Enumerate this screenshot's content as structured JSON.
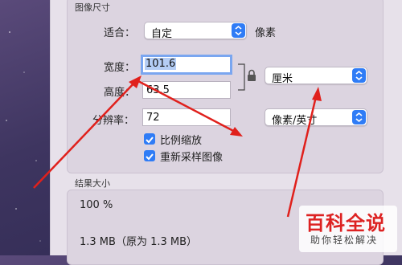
{
  "section_image_size": {
    "title": "图像尺寸"
  },
  "fit": {
    "label": "适合：",
    "value": "自定",
    "unit": "像素"
  },
  "width": {
    "label": "宽度：",
    "value": "101.6"
  },
  "height": {
    "label": "高度：",
    "value": "63.5"
  },
  "length_unit": {
    "value": "厘米"
  },
  "resolution": {
    "label": "分辨率：",
    "value": "72",
    "unit_value": "像素/英寸"
  },
  "options": {
    "scale_proportionally": {
      "label": "比例缩放",
      "checked": true
    },
    "resample": {
      "label": "重新采样图像",
      "checked": true
    }
  },
  "section_result": {
    "title": "结果大小",
    "percent": "100 %",
    "size": "1.3 MB（原为 1.3 MB）"
  },
  "watermark": {
    "main": "百科全说",
    "sub": "助你轻松解决"
  },
  "colors": {
    "accent": "#2f7cf6",
    "arrow": "#e0201c"
  }
}
